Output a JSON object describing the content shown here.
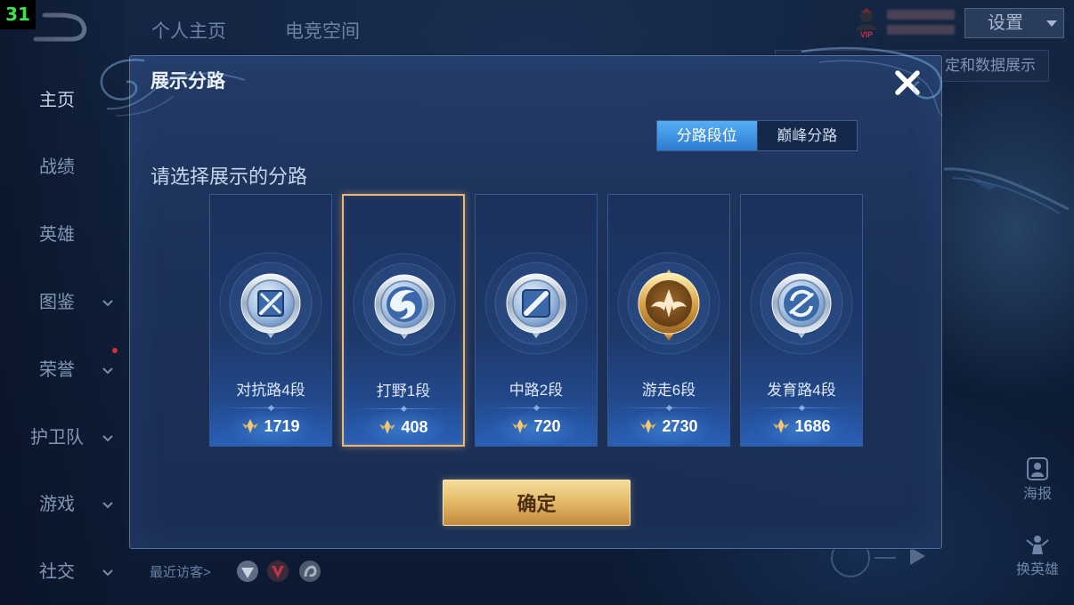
{
  "overlay_counter": "31",
  "background": {
    "top_tabs": [
      "个人主页",
      "电竞空间"
    ],
    "sidebar": [
      {
        "label": "主页",
        "expandable": false,
        "active": true
      },
      {
        "label": "战绩",
        "expandable": false
      },
      {
        "label": "英雄",
        "expandable": false
      },
      {
        "label": "图鉴",
        "expandable": true
      },
      {
        "label": "荣誉",
        "expandable": true,
        "notification_dot": true
      },
      {
        "label": "护卫队",
        "expandable": true
      },
      {
        "label": "游戏",
        "expandable": true
      },
      {
        "label": "社交",
        "expandable": true
      }
    ],
    "vip_badge": "VIP",
    "settings_label": "设置",
    "partially_hidden_banner": "定和数据展示",
    "right_actions": [
      {
        "label": "海报",
        "icon": "poster-icon"
      },
      {
        "label": "换英雄",
        "icon": "swap-hero-icon"
      }
    ],
    "recent_visitors_label": "最近访客>",
    "visitor_avatars": [
      "visitor-avatar-icon",
      "visitor-avatar-icon",
      "visitor-avatar-icon"
    ]
  },
  "dialog": {
    "title": "展示分路",
    "close_icon": "close-icon",
    "tabs": [
      {
        "label": "分路段位",
        "active": true
      },
      {
        "label": "巅峰分路",
        "active": false
      }
    ],
    "prompt": "请选择展示的分路",
    "lanes": [
      {
        "label": "对抗路4段",
        "score": "1719",
        "emblem": "clash-lane-emblem-icon",
        "emblem_color": "#c8d4e2",
        "selected": false
      },
      {
        "label": "打野1段",
        "score": "408",
        "emblem": "jungle-emblem-icon",
        "emblem_color": "#c8d4e2",
        "selected": true
      },
      {
        "label": "中路2段",
        "score": "720",
        "emblem": "mid-lane-emblem-icon",
        "emblem_color": "#c8d4e2",
        "selected": false
      },
      {
        "label": "游走6段",
        "score": "2730",
        "emblem": "roam-emblem-icon",
        "emblem_color": "#d9a24a",
        "selected": false
      },
      {
        "label": "发育路4段",
        "score": "1686",
        "emblem": "farm-lane-emblem-icon",
        "emblem_color": "#c8d4e2",
        "selected": false
      }
    ],
    "score_icon": "rank-points-icon",
    "confirm_label": "确定"
  },
  "colors": {
    "accent_blue": "#3a8ee0",
    "selected_border": "#e8b878",
    "confirm_gold": "#e3b866",
    "counter_green": "#41e04f",
    "notification_red": "#d03030"
  }
}
